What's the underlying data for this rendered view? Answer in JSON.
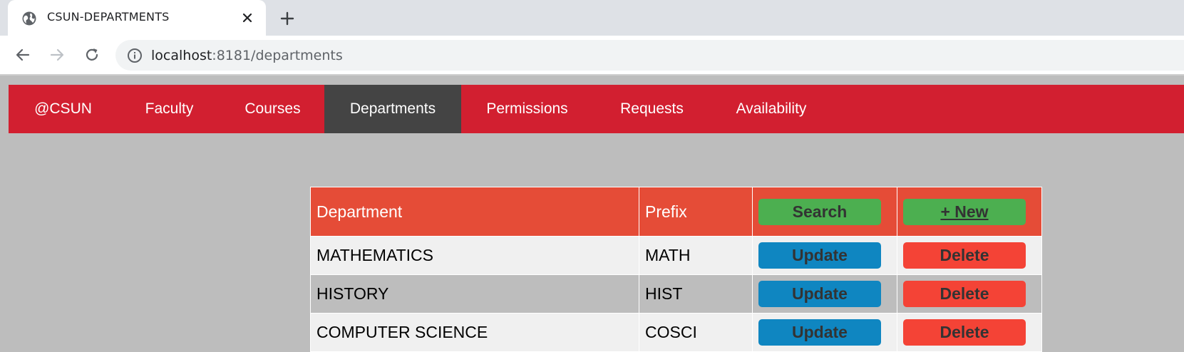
{
  "browser": {
    "tab_title": "CSUN-DEPARTMENTS",
    "url_host": "localhost",
    "url_rest": ":8181/departments"
  },
  "navbar": {
    "items": [
      {
        "label": "@CSUN",
        "active": false
      },
      {
        "label": "Faculty",
        "active": false
      },
      {
        "label": "Courses",
        "active": false
      },
      {
        "label": "Departments",
        "active": true
      },
      {
        "label": "Permissions",
        "active": false
      },
      {
        "label": "Requests",
        "active": false
      },
      {
        "label": "Availability",
        "active": false
      }
    ]
  },
  "table": {
    "headers": {
      "department": "Department",
      "prefix": "Prefix",
      "search_button": "Search",
      "new_button": "+ New"
    },
    "rows": [
      {
        "department": "MATHEMATICS",
        "prefix": "MATH",
        "update": "Update",
        "delete": "Delete"
      },
      {
        "department": "HISTORY",
        "prefix": "HIST",
        "update": "Update",
        "delete": "Delete"
      },
      {
        "department": "COMPUTER SCIENCE",
        "prefix": "COSCI",
        "update": "Update",
        "delete": "Delete"
      }
    ]
  },
  "colors": {
    "navbar_bg": "#d21f30",
    "navbar_active": "#444444",
    "header_bg": "#e54c37",
    "search_green": "#4caf50",
    "update_blue": "#0f86c1",
    "delete_red": "#f44336",
    "page_bg": "#bdbdbd"
  }
}
